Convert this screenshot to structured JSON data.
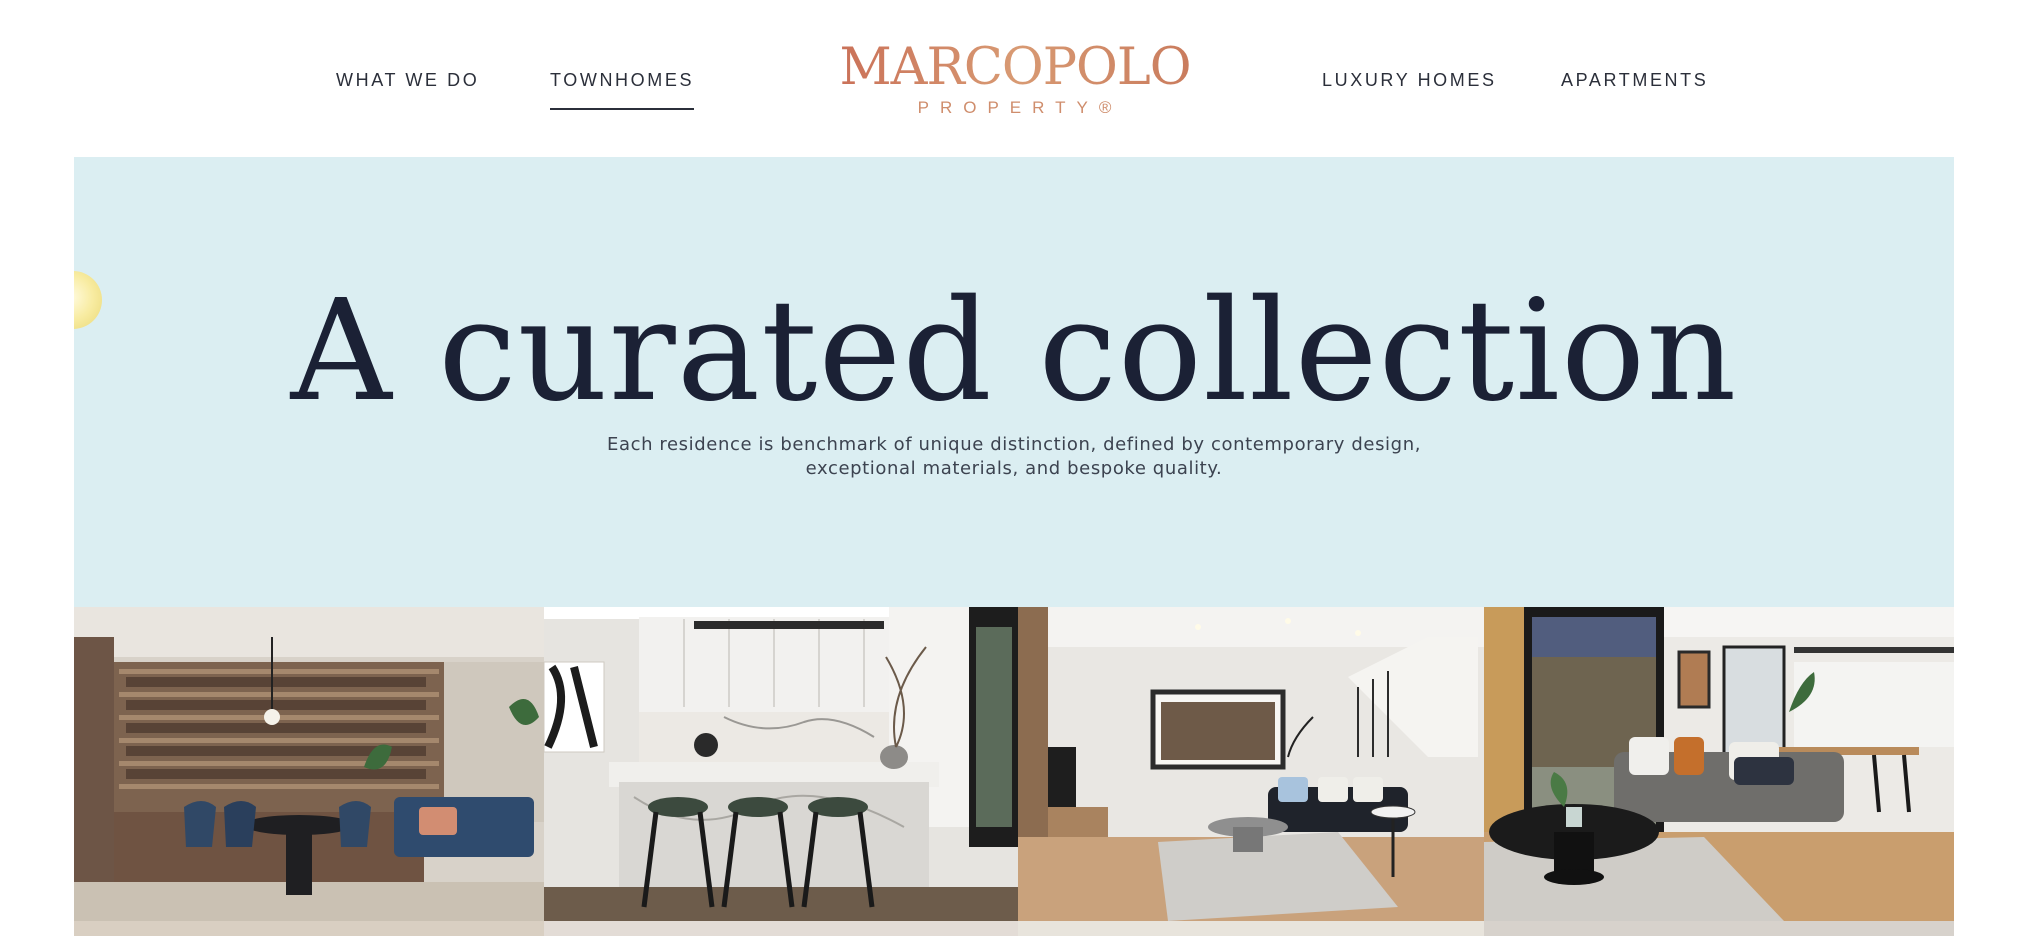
{
  "nav": {
    "left": [
      {
        "label": "WHAT WE DO",
        "active": false
      },
      {
        "label": "TOWNHOMES",
        "active": true
      }
    ],
    "right": [
      {
        "label": "LUXURY HOMES",
        "active": false
      },
      {
        "label": "APARTMENTS",
        "active": false
      }
    ]
  },
  "logo": {
    "name": "MARCOPOLO",
    "tagline": "PROPERTY®"
  },
  "hero": {
    "title": "A curated collection",
    "subtitle_line1": "Each residence is benchmark of unique distinction, defined by contemporary design,",
    "subtitle_line2": "exceptional materials, and bespoke quality."
  },
  "gallery": [
    {
      "icon": "dining-room-photo"
    },
    {
      "icon": "kitchen-photo"
    },
    {
      "icon": "living-room-photo"
    },
    {
      "icon": "lounge-photo"
    }
  ],
  "colors": {
    "hero_background": "#dbeef2",
    "title_navy": "#1b2135",
    "logo_copper": "#c9785c"
  }
}
